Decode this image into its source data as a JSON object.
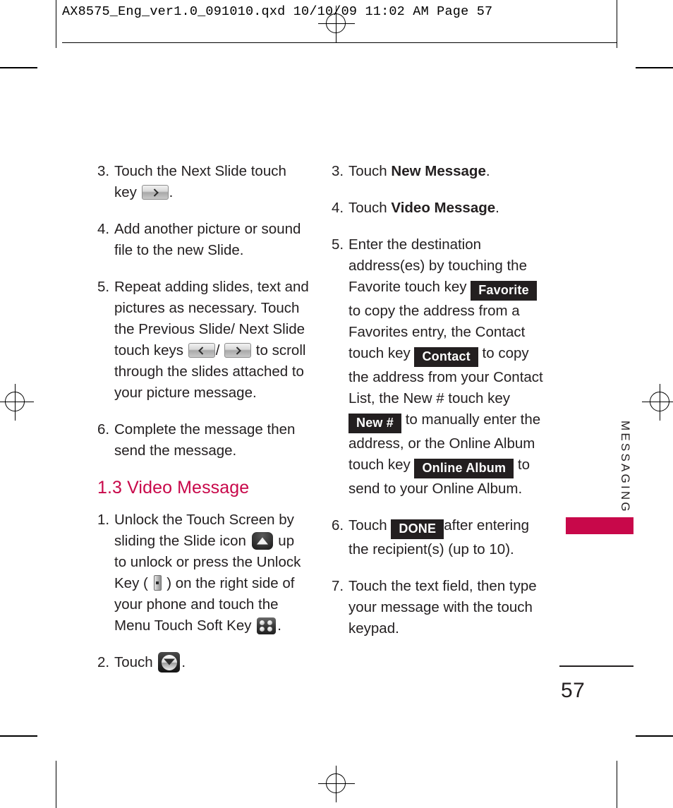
{
  "prepress": {
    "header_line": "AX8575_Eng_ver1.0_091010.qxd   10/10/09   11:02 AM   Page 57"
  },
  "sidebar": {
    "chapter_label": "MESSAGING",
    "tab_color": "#c8084a"
  },
  "folio": {
    "page_number": "57"
  },
  "theme": {
    "heading_color": "#c8084a",
    "text_color": "#231f20",
    "chip_bg": "#231f20",
    "chip_text": "#ffffff"
  },
  "left_column": {
    "steps": [
      {
        "number": "3.",
        "parts": [
          {
            "type": "text",
            "value": "Touch the Next Slide touch key "
          },
          {
            "type": "touchkey",
            "icon": "arrow-right-touch-key"
          },
          {
            "type": "text",
            "value": "."
          }
        ]
      },
      {
        "number": "4.",
        "parts": [
          {
            "type": "text",
            "value": "Add another picture or sound file to the new Slide."
          }
        ]
      },
      {
        "number": "5.",
        "parts": [
          {
            "type": "text",
            "value": "Repeat adding slides, text and pictures as necessary. Touch the Previous Slide/ Next Slide touch keys "
          },
          {
            "type": "touchkey",
            "icon": "arrow-left-touch-key"
          },
          {
            "type": "text",
            "value": "/ "
          },
          {
            "type": "touchkey",
            "icon": "arrow-right-touch-key"
          },
          {
            "type": "text",
            "value": " to scroll through the slides attached to your picture message."
          }
        ]
      },
      {
        "number": "6.",
        "parts": [
          {
            "type": "text",
            "value": "Complete the message then send the message."
          }
        ]
      }
    ],
    "heading": "1.3 Video Message",
    "steps2": [
      {
        "number": "1.",
        "parts": [
          {
            "type": "text",
            "value": "Unlock the Touch Screen by sliding the Slide icon "
          },
          {
            "type": "icon",
            "icon": "slide-up-icon"
          },
          {
            "type": "text",
            "value": " up to unlock or press the Unlock Key ( "
          },
          {
            "type": "icon",
            "icon": "unlock-key-icon"
          },
          {
            "type": "text",
            "value": " ) on the right side of your phone and touch the Menu Touch Soft Key "
          },
          {
            "type": "icon",
            "icon": "menu-soft-key-icon"
          },
          {
            "type": "text",
            "value": "."
          }
        ]
      },
      {
        "number": "2.",
        "parts": [
          {
            "type": "text",
            "value": "Touch "
          },
          {
            "type": "icon",
            "icon": "down-chevron-key-icon"
          },
          {
            "type": "text",
            "value": "."
          }
        ]
      }
    ]
  },
  "right_column": {
    "steps": [
      {
        "number": "3.",
        "parts": [
          {
            "type": "text",
            "value": "Touch "
          },
          {
            "type": "bold",
            "value": "New Message"
          },
          {
            "type": "text",
            "value": "."
          }
        ]
      },
      {
        "number": "4.",
        "parts": [
          {
            "type": "text",
            "value": "Touch "
          },
          {
            "type": "bold",
            "value": "Video Message"
          },
          {
            "type": "text",
            "value": "."
          }
        ]
      },
      {
        "number": "5.",
        "parts": [
          {
            "type": "text",
            "value": "Enter the destination address(es) by touching the Favorite touch key "
          },
          {
            "type": "chip",
            "value": "Favorite"
          },
          {
            "type": "text",
            "value": " to copy the address from a Favorites entry, the Contact touch key "
          },
          {
            "type": "chip",
            "value": "Contact"
          },
          {
            "type": "text",
            "value": " to copy the address from your Contact List, the New # touch key "
          },
          {
            "type": "chip",
            "value": "New #"
          },
          {
            "type": "text",
            "value": " to manually enter the address, or the Online Album touch key "
          },
          {
            "type": "chip",
            "value": "Online Album"
          },
          {
            "type": "text",
            "value": " to send to your Online Album."
          }
        ]
      },
      {
        "number": "6.",
        "parts": [
          {
            "type": "text",
            "value": "Touch "
          },
          {
            "type": "chip",
            "value": "DONE"
          },
          {
            "type": "text",
            "value": "after entering the recipient(s) (up to 10)."
          }
        ]
      },
      {
        "number": "7.",
        "parts": [
          {
            "type": "text",
            "value": "Touch the text field, then type your message with the touch keypad."
          }
        ]
      }
    ]
  }
}
